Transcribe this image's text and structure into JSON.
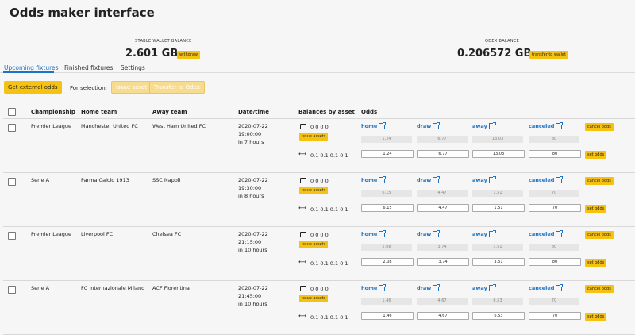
{
  "title": "Odds maker interface",
  "stable": {
    "label": "STABLE WALLET BALANCE",
    "value": "2.601 GB",
    "button": "withdraw"
  },
  "odex": {
    "label": "ODEX BALANCE",
    "value": "0.206572 GB",
    "button": "transfer to wallet"
  },
  "tabs": [
    "Upcoming fixtures",
    "Finished fixtures",
    "Settings"
  ],
  "actions": {
    "get_odds": "Get external odds",
    "for_selection": "For selection:",
    "issue_asset": "Issue asset",
    "transfer": "Transfer to Odex"
  },
  "headers": [
    "Championship",
    "Home team",
    "Away team",
    "Date/time",
    "Balances by asset",
    "Odds"
  ],
  "odds_labels": [
    "home",
    "draw",
    "away",
    "canceled"
  ],
  "buttons": {
    "issue_assets": "issue assets",
    "cancel_odds": "cancel odds",
    "set_odds": "set odds"
  },
  "rows": [
    {
      "championship": "Premier League",
      "home": "Manchester United FC",
      "away": "West Ham United FC",
      "date": "2020-07-22",
      "time": "19:00:00",
      "rel": "in 7 hours",
      "bal": "0 0 0 0",
      "bal2": "0.1  0.1  0.1  0.1",
      "placeholder": [
        "1.24",
        "6.77",
        "13.03",
        "80"
      ],
      "values": [
        "1.24",
        "6.77",
        "13.03",
        "80"
      ]
    },
    {
      "championship": "Serie A",
      "home": "Parma Calcio 1913",
      "away": "SSC Napoli",
      "date": "2020-07-22",
      "time": "19:30:00",
      "rel": "in 8 hours",
      "bal": "0 0 0 0",
      "bal2": "0.1  0.1  0.1  0.1",
      "placeholder": [
        "6.15",
        "4.47",
        "1.51",
        "70"
      ],
      "values": [
        "6.15",
        "4.47",
        "1.51",
        "70"
      ]
    },
    {
      "championship": "Premier League",
      "home": "Liverpool FC",
      "away": "Chelsea FC",
      "date": "2020-07-22",
      "time": "21:15:00",
      "rel": "in 10 hours",
      "bal": "0 0 0 0",
      "bal2": "0.1  0.1  0.1  0.1",
      "placeholder": [
        "2.08",
        "3.74",
        "3.51",
        "80"
      ],
      "values": [
        "2.08",
        "3.74",
        "3.51",
        "80"
      ]
    },
    {
      "championship": "Serie A",
      "home": "FC Internazionale Milano",
      "away": "ACF Fiorentina",
      "date": "2020-07-22",
      "time": "21:45:00",
      "rel": "in 10 hours",
      "bal": "0 0 0 0",
      "bal2": "0.1  0.1  0.1  0.1",
      "placeholder": [
        "1.46",
        "4.67",
        "6.53",
        "70"
      ],
      "values": [
        "1.46",
        "4.67",
        "6.53",
        "70"
      ]
    }
  ]
}
